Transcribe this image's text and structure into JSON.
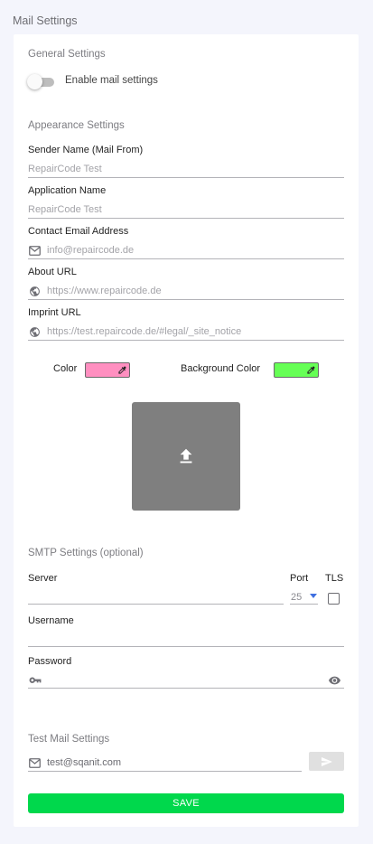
{
  "page": {
    "title": "Mail Settings"
  },
  "general": {
    "title": "General Settings",
    "enable_label": "Enable mail settings",
    "enabled": false
  },
  "appearance": {
    "title": "Appearance Settings",
    "sender_name": {
      "label": "Sender Name (Mail From)",
      "placeholder": "RepairCode Test"
    },
    "application_name": {
      "label": "Application Name",
      "placeholder": "RepairCode Test"
    },
    "contact_email": {
      "label": "Contact Email Address",
      "placeholder": "info@repaircode.de",
      "icon": "mail-icon"
    },
    "about_url": {
      "label": "About URL",
      "placeholder": "https://www.repaircode.de",
      "icon": "globe-icon"
    },
    "imprint_url": {
      "label": "Imprint URL",
      "placeholder": "https://test.repaircode.de/#legal/_site_notice",
      "icon": "globe-icon"
    },
    "color": {
      "label": "Color",
      "value": "#ff8fc0",
      "icon": "eyedropper-icon"
    },
    "background_color": {
      "label": "Background Color",
      "value": "#66ff55",
      "icon": "eyedropper-icon"
    },
    "upload_icon": "upload-icon"
  },
  "smtp": {
    "title": "SMTP Settings (optional)",
    "server": {
      "label": "Server",
      "value": ""
    },
    "port": {
      "label": "Port",
      "value": "25"
    },
    "tls": {
      "label": "TLS",
      "checked": false
    },
    "username": {
      "label": "Username",
      "value": ""
    },
    "password": {
      "label": "Password",
      "value": "",
      "icon": "key-icon",
      "toggle_icon": "eye-icon"
    }
  },
  "test_mail": {
    "title": "Test Mail Settings",
    "email": {
      "value": "test@sqanit.com",
      "icon": "mail-icon"
    },
    "send_icon": "send-icon"
  },
  "save_label": "SAVE",
  "colors": {
    "accent": "#00d84c",
    "dropdown_arrow": "#3f6fe0"
  }
}
